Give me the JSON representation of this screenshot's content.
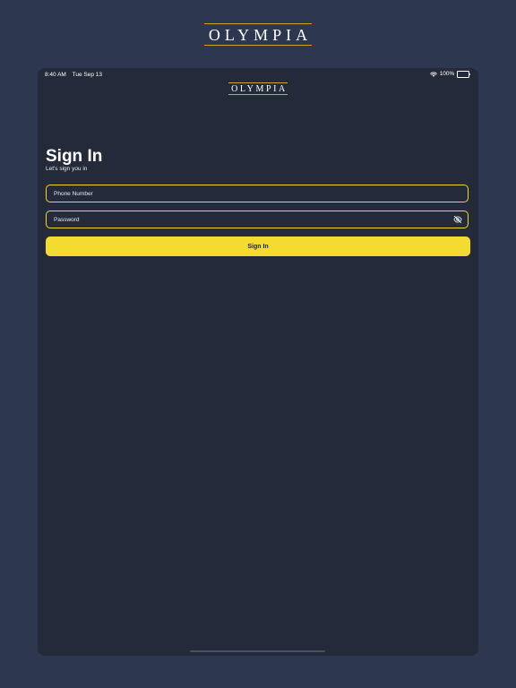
{
  "brand": {
    "outer_logo_text": "OLYMPIA",
    "inner_logo_text": "OLYMPIA"
  },
  "status_bar": {
    "time": "8:40 AM",
    "date": "Tue Sep 13",
    "battery_percent": "100%",
    "icons": [
      "wifi-icon",
      "battery-icon"
    ]
  },
  "signin": {
    "title": "Sign In",
    "subtitle": "Let's sign you in",
    "phone_placeholder": "Phone Number",
    "password_placeholder": "Password",
    "password_toggle_icon": "eye-off-icon",
    "submit_label": "Sign In"
  },
  "colors": {
    "page_background": "#2d3750",
    "screen_background": "#252a3a",
    "accent_yellow": "#f4db31",
    "logo_rule_gold": "#c9a52a"
  }
}
